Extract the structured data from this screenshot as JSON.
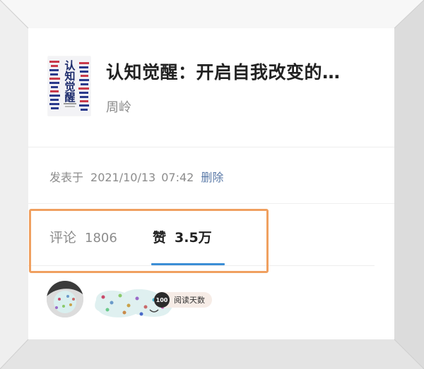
{
  "book": {
    "cover_title": "认知觉醒",
    "title": "认知觉醒：开启自我改变的…",
    "author": "周岭"
  },
  "meta": {
    "prefix": "发表于",
    "date": "2021/10/13",
    "time": "07:42",
    "delete_label": "删除"
  },
  "tabs": {
    "comments_label": "评论",
    "comments_count": "1806",
    "likes_label": "赞",
    "likes_count": "3.5万",
    "active": "likes"
  },
  "user": {
    "badge_number": "100",
    "badge_label": "阅读天数"
  },
  "colors": {
    "accent": "#3b8ed6",
    "highlight": "#f0a060",
    "link": "#5b7aa8"
  }
}
